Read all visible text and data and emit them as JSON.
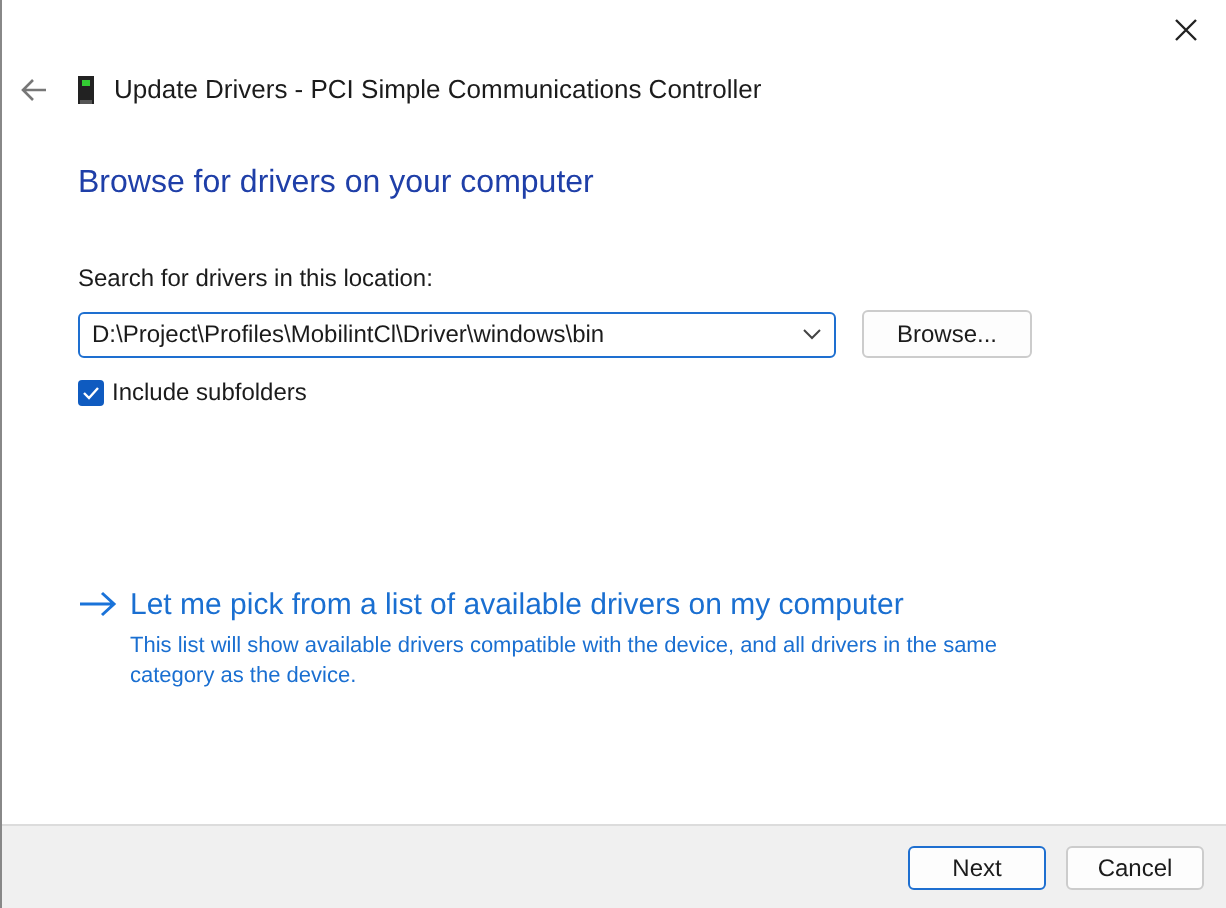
{
  "window": {
    "title": "Update Drivers - PCI Simple Communications Controller"
  },
  "heading": "Browse for drivers on your computer",
  "location": {
    "label": "Search for drivers in this location:",
    "value": "D:\\Project\\Profiles\\MobilintCl\\Driver\\windows\\bin",
    "browse": "Browse..."
  },
  "include_subfolders": {
    "label": "Include subfolders",
    "checked": true
  },
  "pick_link": {
    "title": "Let me pick from a list of available drivers on my computer",
    "description": "This list will show available drivers compatible with the device, and all drivers in the same category as the device."
  },
  "buttons": [
    {
      "label": "Next",
      "default": true
    },
    {
      "label": "Cancel",
      "default": false
    }
  ]
}
